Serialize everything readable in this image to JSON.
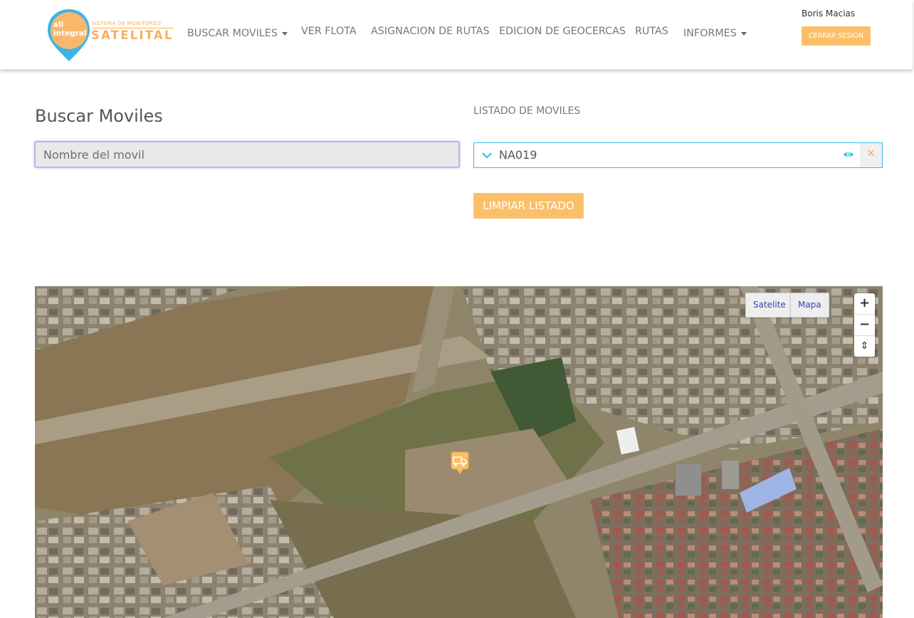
{
  "brand": {
    "pin_text": "all integral",
    "subtitle": "SISTEMA DE MONITOREO",
    "name": "SATELITAL",
    "accent_color": "#fbbf6a",
    "pin_color": "#3cb4ea"
  },
  "nav": {
    "items": [
      {
        "label": "BUSCAR MOVILES",
        "dropdown": true
      },
      {
        "label": "VER FLOTA",
        "dropdown": false
      },
      {
        "label": "ASIGNACION DE RUTAS",
        "dropdown": false
      },
      {
        "label": "EDICION DE GEOCERCAS",
        "dropdown": false
      },
      {
        "label": "RUTAS",
        "dropdown": false
      },
      {
        "label": "INFORMES",
        "dropdown": true
      }
    ]
  },
  "user": {
    "name": "Boris Macias",
    "logout_label": "CERRAR SESION"
  },
  "search": {
    "title": "Buscar Moviles",
    "placeholder": "Nombre del movil",
    "value": ""
  },
  "mobile_list": {
    "heading": "LISTADO DE MOVILES",
    "items": [
      {
        "name": "NA019",
        "icons": [
          "chevron-down-icon",
          "eye-icon",
          "close-icon"
        ]
      }
    ],
    "clear_label": "LIMPIAR LISTADO"
  },
  "map": {
    "layer_buttons": [
      "Satelite",
      "Mapa"
    ],
    "zoom_in": "+",
    "zoom_out": "−",
    "compass": "⇕",
    "marker_icon": "truck-icon",
    "marker_color": "#fbbf6a"
  }
}
